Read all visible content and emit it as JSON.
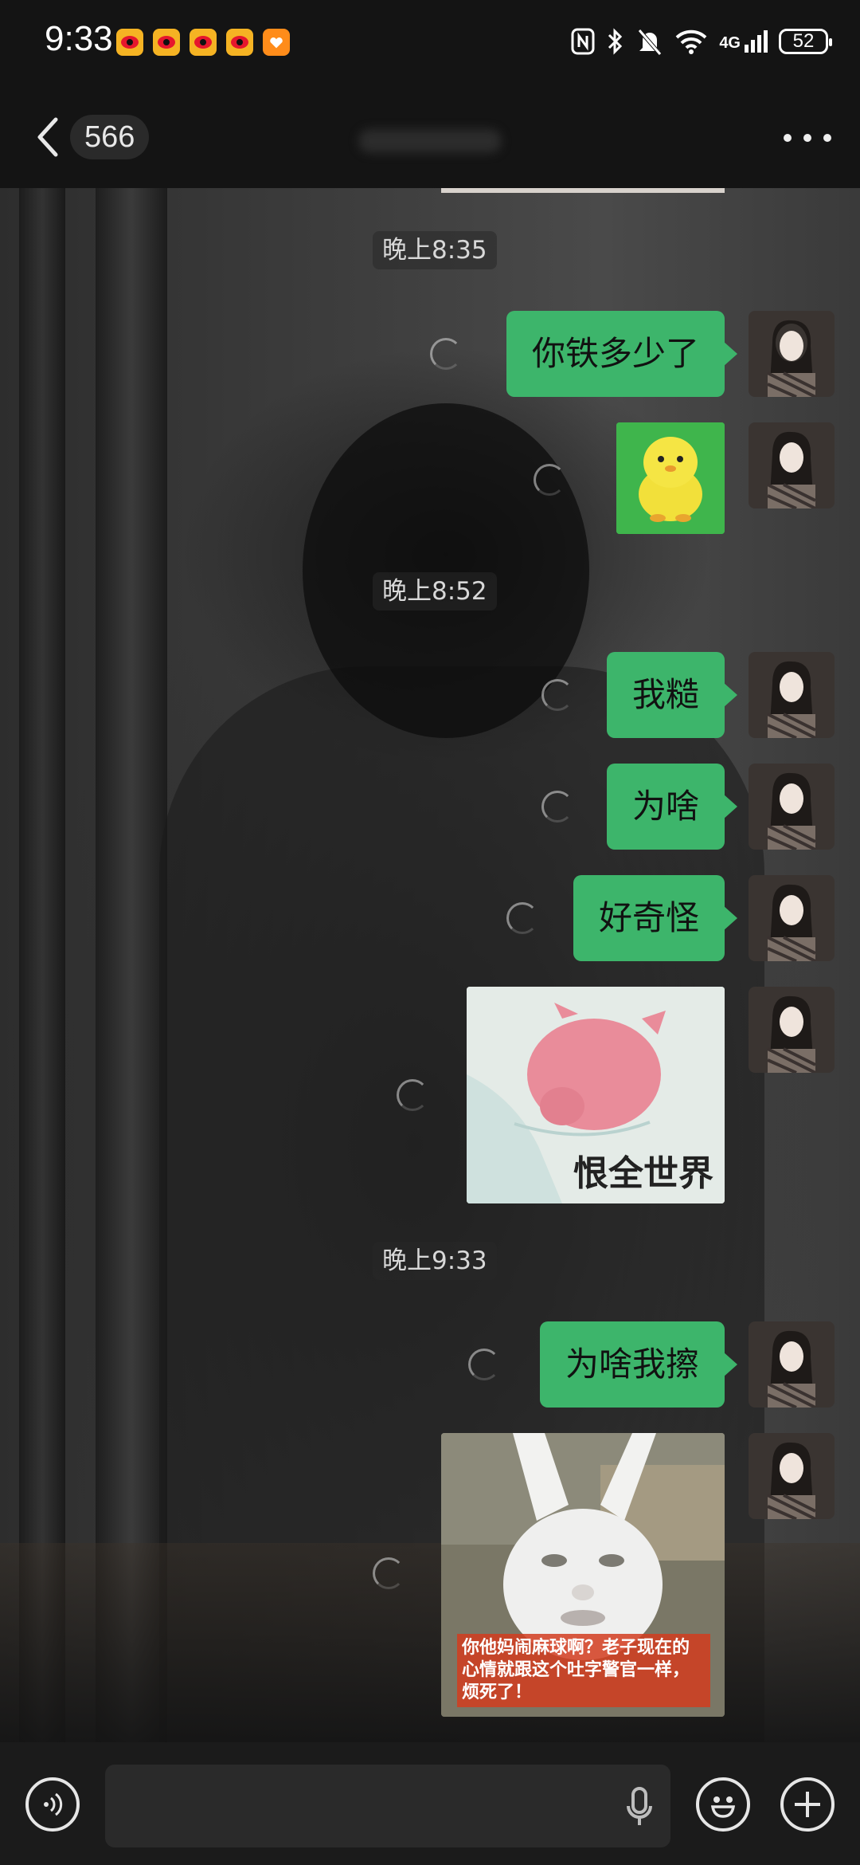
{
  "status_bar": {
    "time": "9:33",
    "battery": "52",
    "network": "4G",
    "notification_icons": [
      "weibo-icon",
      "weibo-icon",
      "weibo-icon",
      "weibo-icon",
      "app-notification-icon"
    ],
    "system_icons": [
      "nfc-icon",
      "bluetooth-icon",
      "mute-icon",
      "wifi-icon",
      "signal-icon",
      "battery-icon"
    ]
  },
  "header": {
    "back_icon": "chevron-left-icon",
    "unread_count": "566",
    "more_icon": "more-icon"
  },
  "colors": {
    "bubble": "#3db56b",
    "header_bg": "#141414",
    "bottom_bg": "#1b1b1b"
  },
  "messages": {
    "t1": "晚上8:35",
    "m1": "你铁多少了",
    "s1": "yellow-chick-sticker",
    "t2": "晚上8:52",
    "m2": "我糙",
    "m3": "为啥",
    "m4": "好奇怪",
    "s2_caption": "恨全世界",
    "t3": "晚上9:33",
    "m5": "为啥我擦",
    "s3_caption": "你他妈闹麻球啊？老子现在的心情就跟这个吐字警官一样，烦死了！"
  },
  "bottom_bar": {
    "voice_icon": "voice-icon",
    "mic_icon": "mic-icon",
    "emoji_icon": "emoji-icon",
    "plus_icon": "plus-icon"
  }
}
